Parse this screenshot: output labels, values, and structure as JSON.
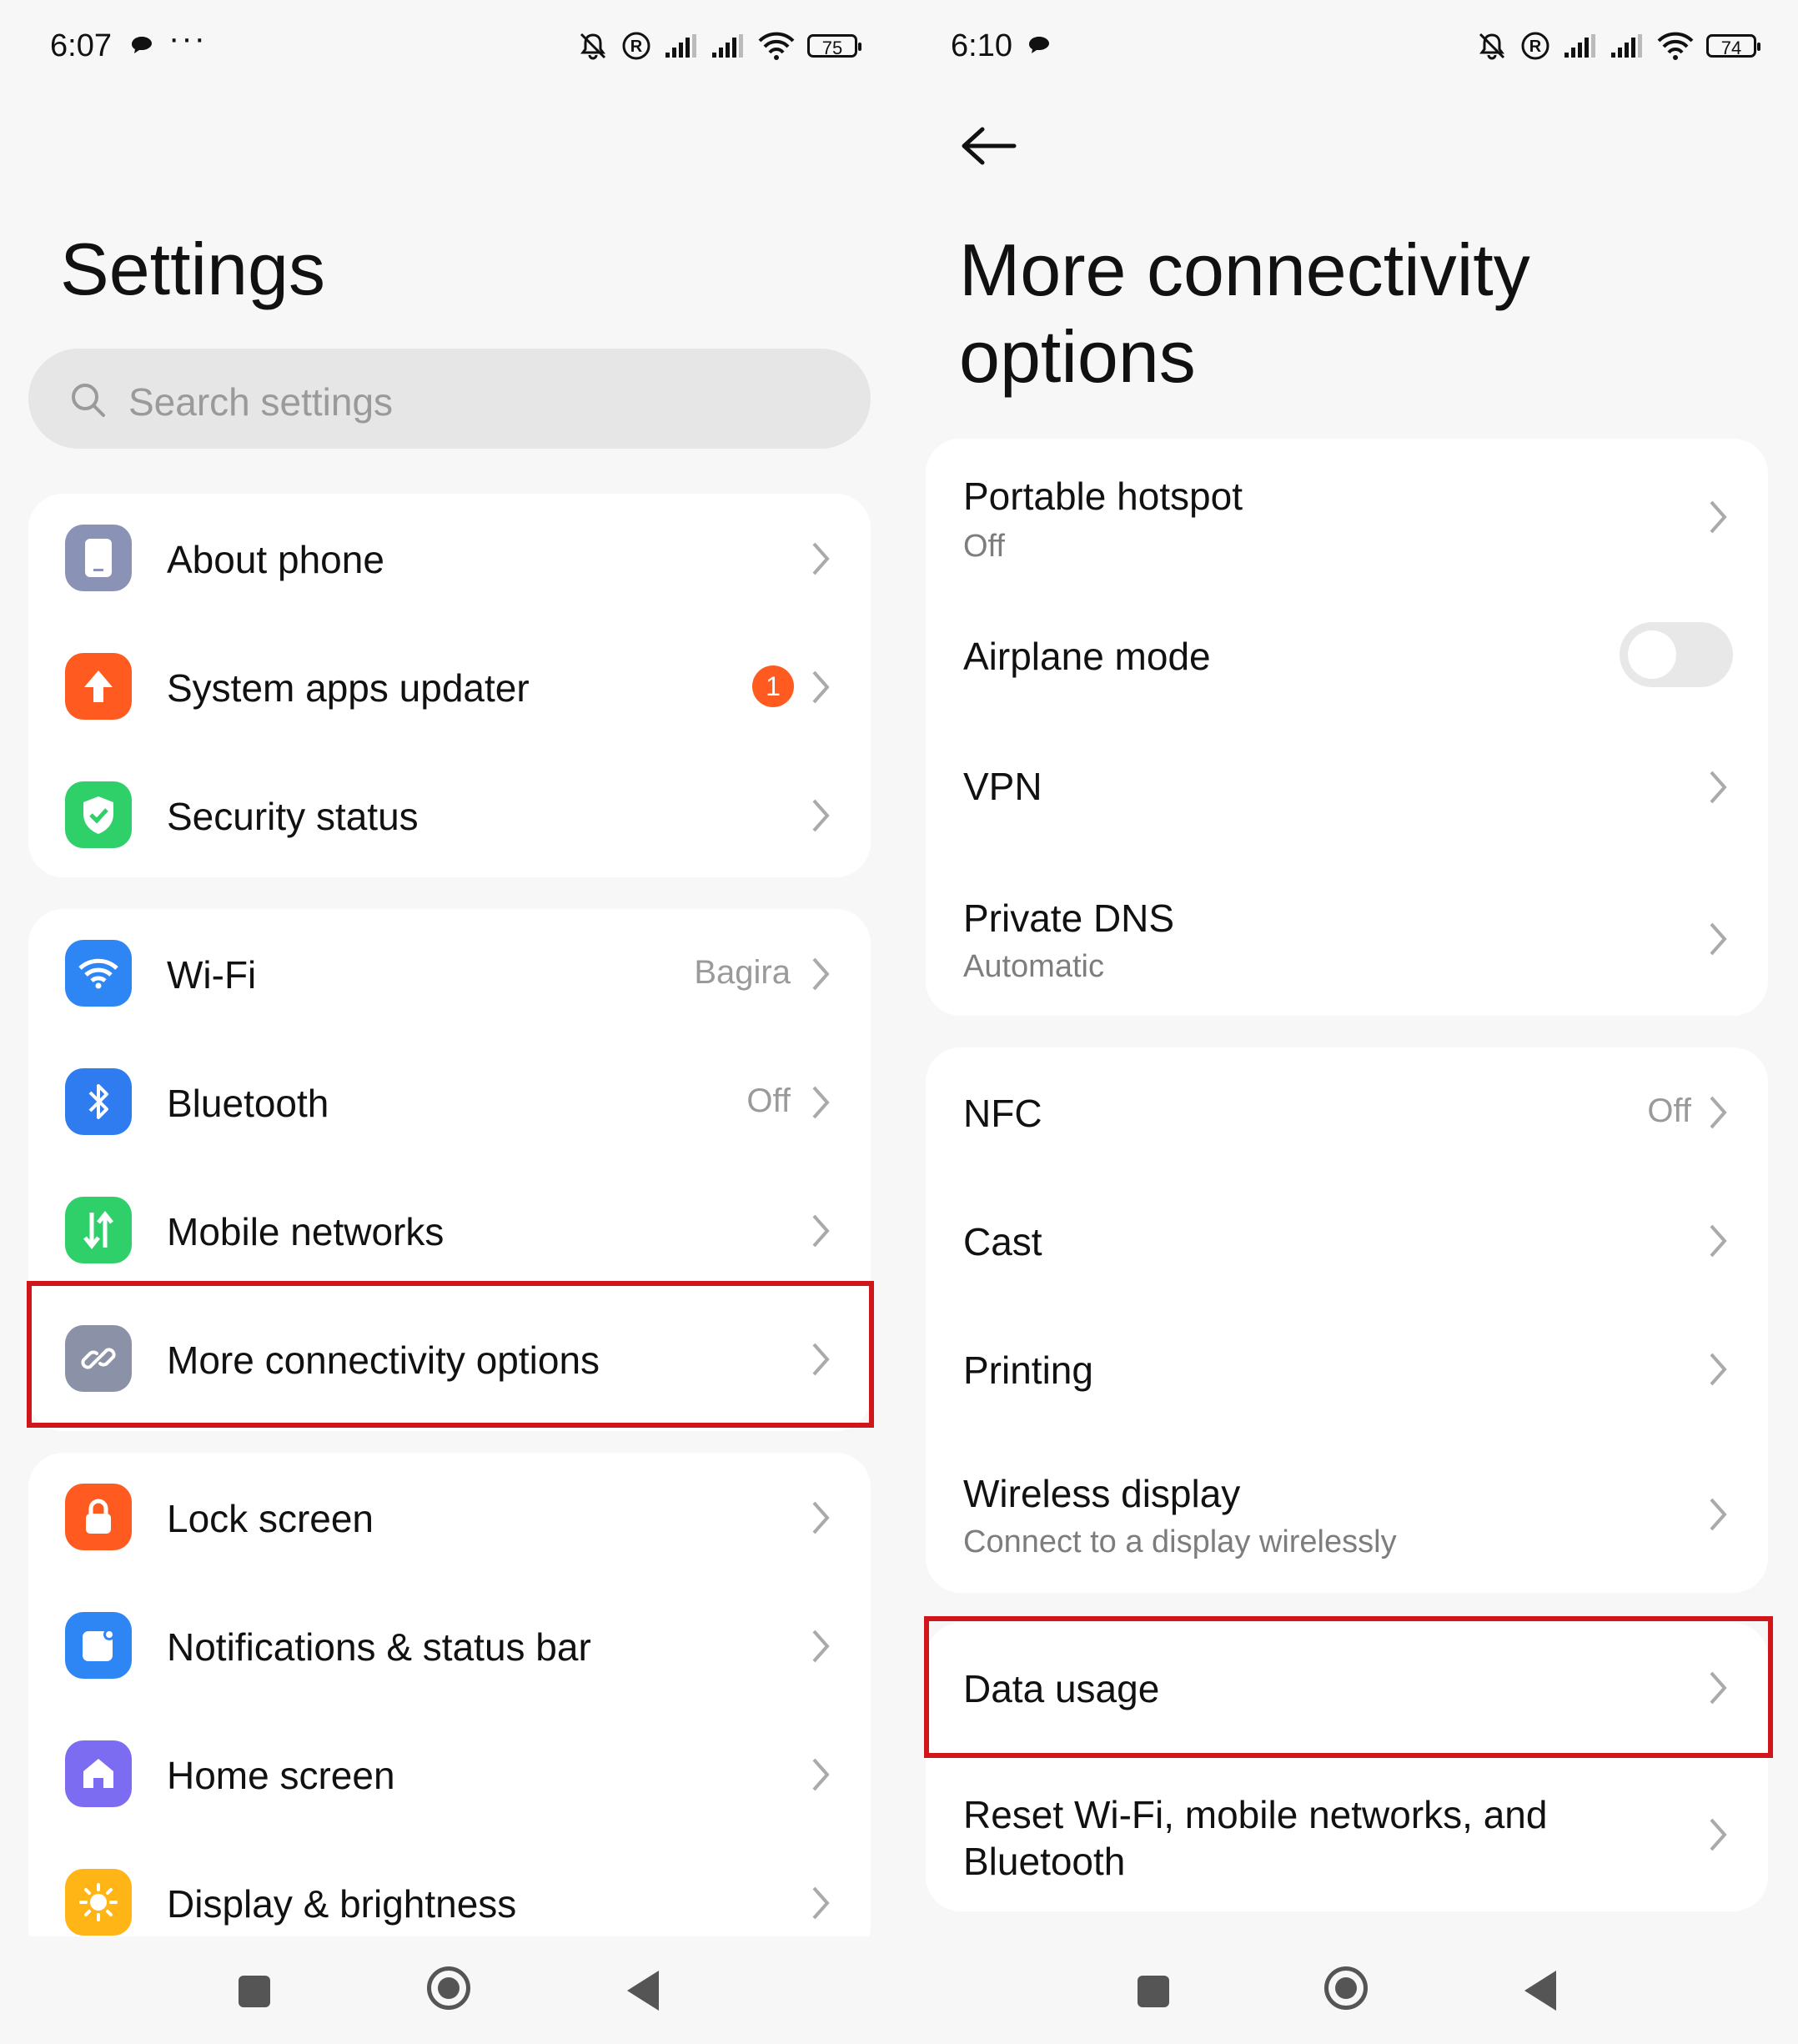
{
  "left": {
    "status": {
      "time": "6:07",
      "battery": "75"
    },
    "title": "Settings",
    "search": {
      "placeholder": "Search settings"
    },
    "group1": [
      {
        "label": "About phone"
      },
      {
        "label": "System apps updater",
        "badge": "1"
      },
      {
        "label": "Security status"
      }
    ],
    "group2": [
      {
        "label": "Wi-Fi",
        "value": "Bagira"
      },
      {
        "label": "Bluetooth",
        "value": "Off"
      },
      {
        "label": "Mobile networks"
      },
      {
        "label": "More connectivity options"
      }
    ],
    "group3": [
      {
        "label": "Lock screen"
      },
      {
        "label": "Notifications & status bar"
      },
      {
        "label": "Home screen"
      },
      {
        "label": "Display & brightness"
      }
    ]
  },
  "right": {
    "status": {
      "time": "6:10",
      "battery": "74"
    },
    "title_line1": "More connectivity",
    "title_line2": "options",
    "group1": [
      {
        "label": "Portable hotspot",
        "sub": "Off"
      },
      {
        "label": "Airplane mode",
        "toggle": false
      },
      {
        "label": "VPN"
      },
      {
        "label": "Private DNS",
        "sub": "Automatic"
      }
    ],
    "group2": [
      {
        "label": "NFC",
        "value": "Off"
      },
      {
        "label": "Cast"
      },
      {
        "label": "Printing"
      },
      {
        "label": "Wireless display",
        "sub": "Connect to a display wirelessly"
      }
    ],
    "group3": [
      {
        "label": "Data usage"
      },
      {
        "label_line1": "Reset Wi-Fi, mobile networks, and",
        "label_line2": "Bluetooth"
      }
    ]
  },
  "colors": {
    "highlight": "#d0151b",
    "about": "#8a93b5",
    "updater": "#ff5a1f",
    "security": "#2fcf6a",
    "wifi": "#2e86f5",
    "bluetooth": "#2e7cf0",
    "mobile": "#2fcf6a",
    "connectivity": "#8b92a8",
    "lock": "#ff5a1f",
    "notifications": "#2e86f5",
    "home": "#7b6cf2",
    "display": "#ffb515"
  }
}
